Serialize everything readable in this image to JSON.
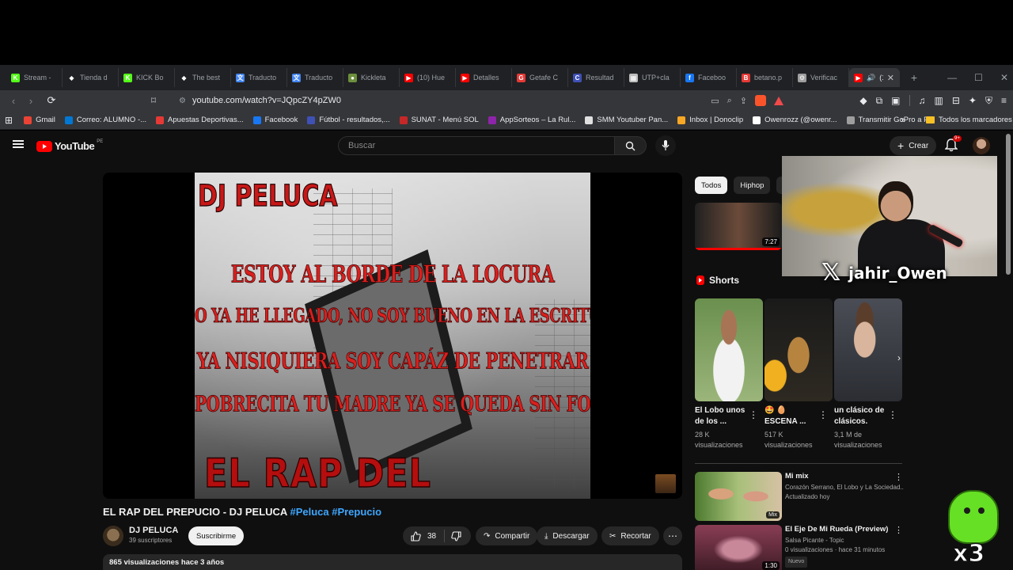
{
  "browser": {
    "tabs": [
      {
        "label": "Stream -",
        "color": "#53fc18",
        "glyph": "K"
      },
      {
        "label": "Tienda d",
        "color": "#ffffff",
        "glyph": "◆"
      },
      {
        "label": "KICK Bo",
        "color": "#53fc18",
        "glyph": "K"
      },
      {
        "label": "The best",
        "color": "#ffffff",
        "glyph": "◆"
      },
      {
        "label": "Traducto",
        "color": "#4285f4",
        "glyph": "文"
      },
      {
        "label": "Traducto",
        "color": "#4285f4",
        "glyph": "文"
      },
      {
        "label": "Kickleta",
        "color": "#6c8f3c",
        "glyph": "●"
      },
      {
        "label": "(10) Hue",
        "color": "#ff0000",
        "glyph": "▶"
      },
      {
        "label": "Detalles",
        "color": "#ff0000",
        "glyph": "▶"
      },
      {
        "label": "Getafe C",
        "color": "#e53935",
        "glyph": "G"
      },
      {
        "label": "Resultad",
        "color": "#3f51b5",
        "glyph": "C"
      },
      {
        "label": "UTP+cla",
        "color": "#bdbdbd",
        "glyph": "▦"
      },
      {
        "label": "Faceboo",
        "color": "#1877f2",
        "glyph": "f"
      },
      {
        "label": "betano.p",
        "color": "#e53935",
        "glyph": "B"
      },
      {
        "label": "Verificac",
        "color": "#9e9e9e",
        "glyph": "⚙"
      }
    ],
    "active_tab": {
      "label": "(1",
      "color": "#ff0000"
    },
    "url": "youtube.com/watch?v=JQpcZY4pZW0",
    "bookmarks": [
      {
        "label": "Gmail",
        "color": "#ea4335"
      },
      {
        "label": "Correo: ALUMNO -...",
        "color": "#0078d4"
      },
      {
        "label": "Apuestas Deportivas...",
        "color": "#e53935"
      },
      {
        "label": "Facebook",
        "color": "#1877f2"
      },
      {
        "label": "Fútbol - resultados,...",
        "color": "#3f51b5"
      },
      {
        "label": "SUNAT - Menú SOL",
        "color": "#c62828"
      },
      {
        "label": "AppSorteos – La Rul...",
        "color": "#8e24aa"
      },
      {
        "label": "SMM Youtuber Pan...",
        "color": "#e0e0e0"
      },
      {
        "label": "Inbox | Donoclip",
        "color": "#f9a825"
      },
      {
        "label": "Owenrozz (@owenr...",
        "color": "#ffffff"
      },
      {
        "label": "Transmitir GoPro a PC",
        "color": "#9e9e9e"
      }
    ],
    "bookmarks_all": "Todos los marcadores"
  },
  "youtube": {
    "logo_text": "YouTube",
    "country": "PE",
    "search_placeholder": "Buscar",
    "create_label": "Crear",
    "notif_badge": "9+"
  },
  "video": {
    "overlay_top": "DJ PELUCA",
    "lyrics": [
      "ESTOY AL BORDE DE LA LOCURA",
      "O YA HE LLEGADO, NO SOY BUENO EN LA ESCRITURA",
      "YA NISIQUIERA SOY CAPÁZ DE PENETRAR",
      "POBRECITA TU MADRE YA SE QUEDA SIN FOLLAR"
    ],
    "overlay_bottom": "EL RAP DEL PREPUCIO",
    "title": "EL RAP DEL PREPUCIO - DJ PELUCA",
    "hashtags": "#Peluca #Prepucio",
    "channel": "DJ PELUCA",
    "subscribers": "39 suscriptores",
    "subscribe_label": "Suscribirme",
    "likes": "38",
    "share_label": "Compartir",
    "download_label": "Descargar",
    "clip_label": "Recortar",
    "views_date": "865 visualizaciones  hace 3 años"
  },
  "sidebar": {
    "chips": [
      "Todos",
      "Hiphop",
      "R"
    ],
    "first_duration": "7:27",
    "shorts_title": "Shorts",
    "shorts": [
      {
        "title": "El Lobo unos de los ...",
        "views": "28 K visualizaciones"
      },
      {
        "title": "🤩 🥚 ESCENA ...",
        "views": "517 K visualizaciones"
      },
      {
        "title": "un clásico de clásicos.",
        "views": "3,1 M de visualizaciones"
      }
    ],
    "recs": [
      {
        "title": "Mi mix",
        "meta1": "Corazón Serrano, El Lobo y La Sociedad...",
        "meta2": "Actualizado hoy",
        "badge": "Mix"
      },
      {
        "title": "El Eje De Mi Rueda (Preview)",
        "meta1": "Salsa Picante - Topic",
        "meta2": "0 visualizaciones · hace 31 minutos",
        "new": "Nuevo",
        "duration": "1:30"
      }
    ]
  },
  "overlay": {
    "handle": "jahir_Owen",
    "x3": "x3"
  }
}
